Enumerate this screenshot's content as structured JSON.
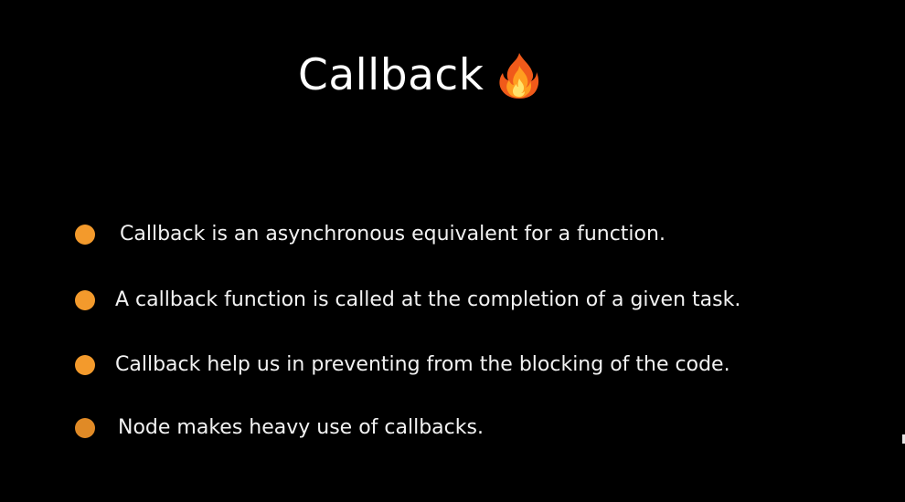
{
  "slide": {
    "title": "Callback",
    "title_icon": "fire-icon",
    "background_color": "#000000",
    "accent_color": "#f39a2c",
    "bullets": [
      {
        "text": "Callback is an asynchronous equivalent for a function.",
        "color": "#f39a2c"
      },
      {
        "text": "A callback function is called at the completion of a given task.",
        "color": "#f39a2c"
      },
      {
        "text": "Callback help us in preventing from the blocking of the code.",
        "color": "#f39a2c"
      },
      {
        "text": "Node makes heavy use of callbacks.",
        "color": "#e08a26"
      }
    ]
  }
}
